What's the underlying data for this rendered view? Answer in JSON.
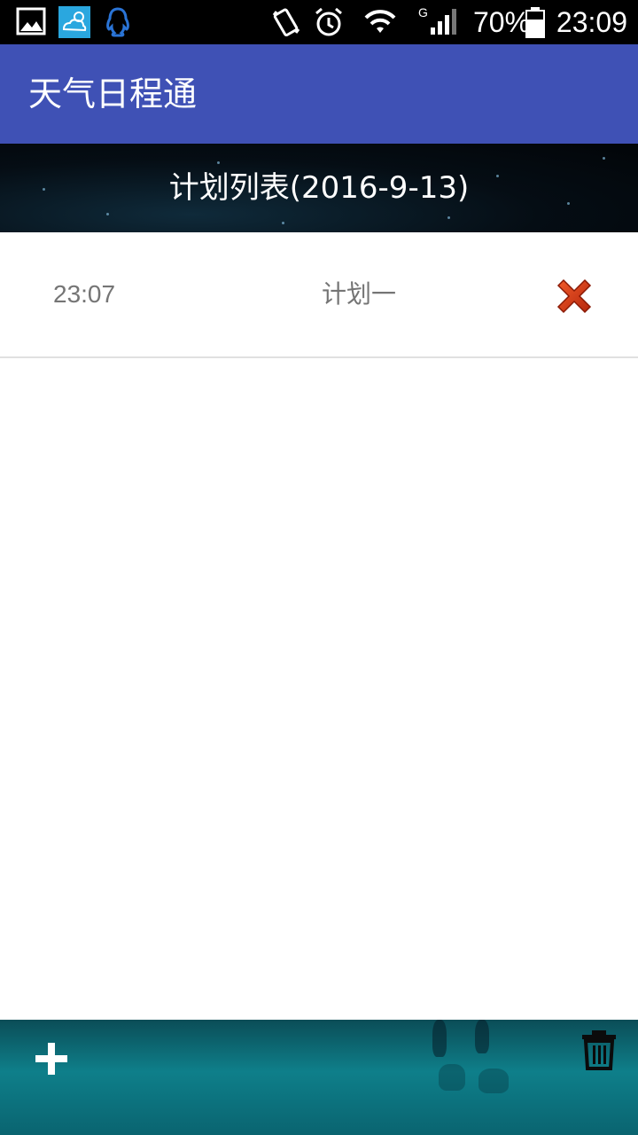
{
  "status_bar": {
    "battery_percent": "70%",
    "time": "23:09",
    "network_type": "G",
    "icons": [
      "gallery-icon",
      "weather-app-icon",
      "qq-icon",
      "vibrate-icon",
      "alarm-icon",
      "wifi-icon",
      "signal-icon",
      "battery-icon"
    ]
  },
  "app_bar": {
    "title": "天气日程通"
  },
  "list_header": {
    "title": "计划列表(2016-9-13)"
  },
  "plans": [
    {
      "time": "23:07",
      "name": "计划一",
      "delete_icon": "close-icon"
    }
  ],
  "bottom_bar": {
    "add_icon": "plus-icon",
    "delete_all_icon": "trash-icon"
  },
  "colors": {
    "app_bar": "#3f51b5",
    "delete_icon": "#d73a12",
    "row_text": "#757575"
  }
}
